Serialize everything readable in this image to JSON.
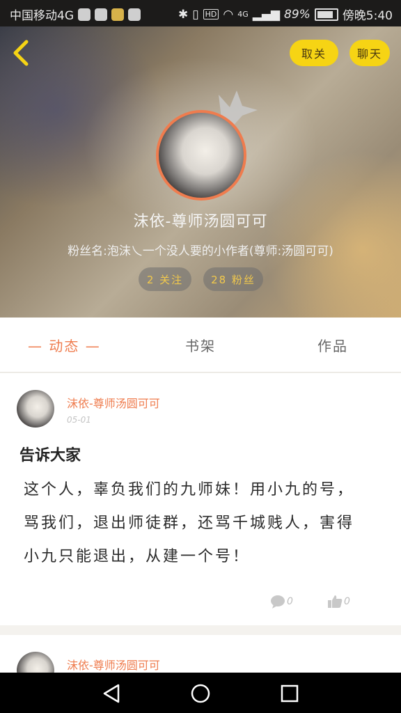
{
  "status_bar": {
    "carrier": "中国移动4G",
    "battery_percent": "89%",
    "time": "傍晚5:40",
    "network": "4G",
    "hd_label": "HD"
  },
  "header": {
    "unfollow_label": "取关",
    "chat_label": "聊天",
    "name": "沫依-尊师汤圆可可",
    "fan_name": "粉丝名:泡沫乀一个没人要的小作者(尊师:汤圆可可)",
    "follow_count_label": "2 关注",
    "fans_count_label": "28 粉丝"
  },
  "tabs": [
    {
      "label": "— 动态 —",
      "active": true
    },
    {
      "label": "书架",
      "active": false
    },
    {
      "label": "作品",
      "active": false
    }
  ],
  "post": {
    "author": "沫依-尊师汤圆可可",
    "date": "05-01",
    "title": "告诉大家",
    "body": "这个人，辜负我们的九师妹！用小九的号，骂我们，退出师徒群，还骂千城贱人，害得小九只能退出，从建一个号！",
    "comment_count": "0",
    "like_count": "0"
  },
  "post2": {
    "author": "沫依-尊师汤圆可可"
  },
  "colors": {
    "accent": "#ef7c4e",
    "button_yellow": "#f6d414",
    "chip_text": "#f2c94c"
  }
}
